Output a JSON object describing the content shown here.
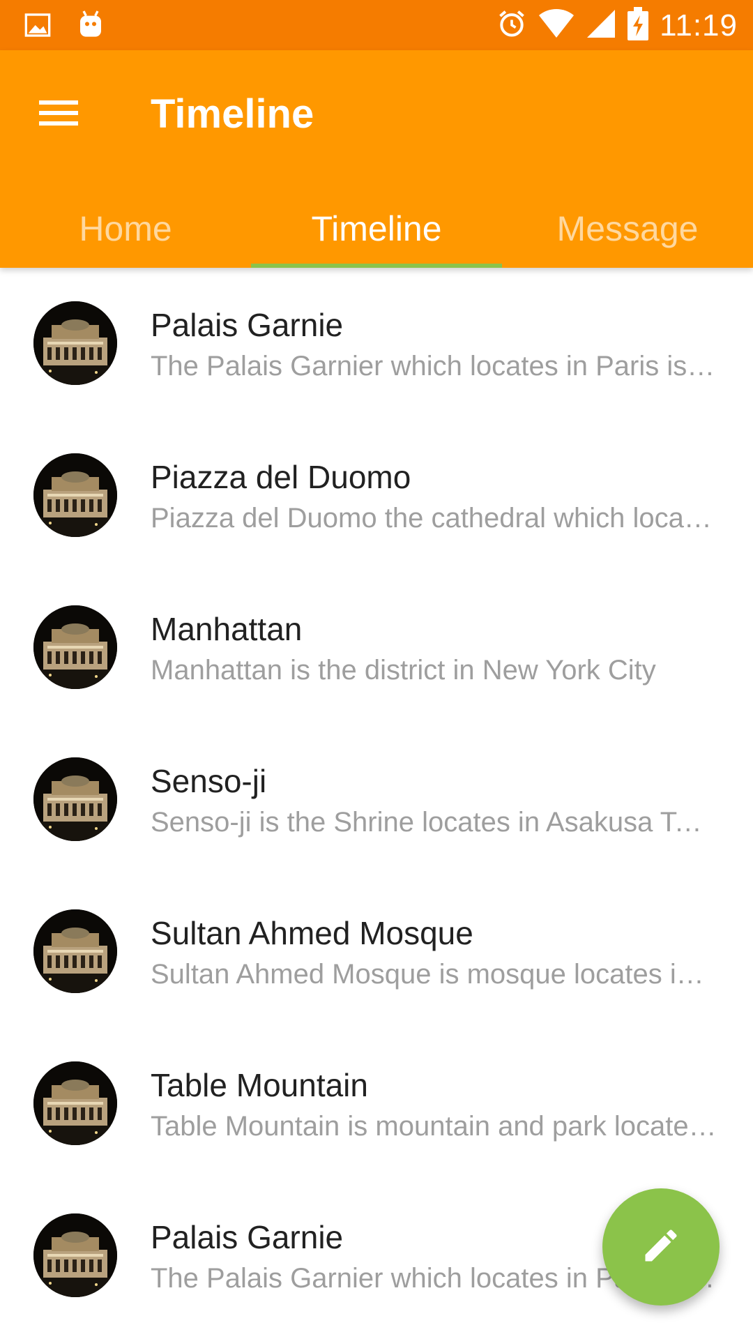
{
  "status_bar": {
    "time": "11:19",
    "icons": [
      "image-icon",
      "android-icon",
      "alarm-icon",
      "wifi-icon",
      "signal-icon",
      "battery-charging-icon"
    ]
  },
  "app_bar": {
    "title": "Timeline",
    "menu_icon": "menu-icon",
    "background_color": "#ff9800"
  },
  "tabs": [
    {
      "label": "Home",
      "active": false
    },
    {
      "label": "Timeline",
      "active": true
    },
    {
      "label": "Message",
      "active": false
    }
  ],
  "list": [
    {
      "title": "Palais Garnie",
      "subtitle": "The Palais Garnier which locates in Paris is the opera house"
    },
    {
      "title": "Piazza del Duomo",
      "subtitle": "Piazza del Duomo the cathedral which locates in Pisa"
    },
    {
      "title": "Manhattan",
      "subtitle": "Manhattan is the district in New York City"
    },
    {
      "title": "Senso-ji",
      "subtitle": "Senso-ji is the Shrine locates in Asakusa Tokyo"
    },
    {
      "title": "Sultan Ahmed Mosque",
      "subtitle": "Sultan Ahmed Mosque is mosque locates in Istanbul"
    },
    {
      "title": "Table Mountain",
      "subtitle": "Table Mountain is mountain and park locates in Cape Town"
    },
    {
      "title": "Palais Garnie",
      "subtitle": "The Palais Garnier which locates in Paris is the opera house"
    }
  ],
  "fab": {
    "icon": "pencil-icon",
    "color": "#8bc34a"
  },
  "colors": {
    "status_bar": "#f57c00",
    "accent": "#8bc34a",
    "title_text": "#212121",
    "secondary_text": "#9e9e9e"
  }
}
